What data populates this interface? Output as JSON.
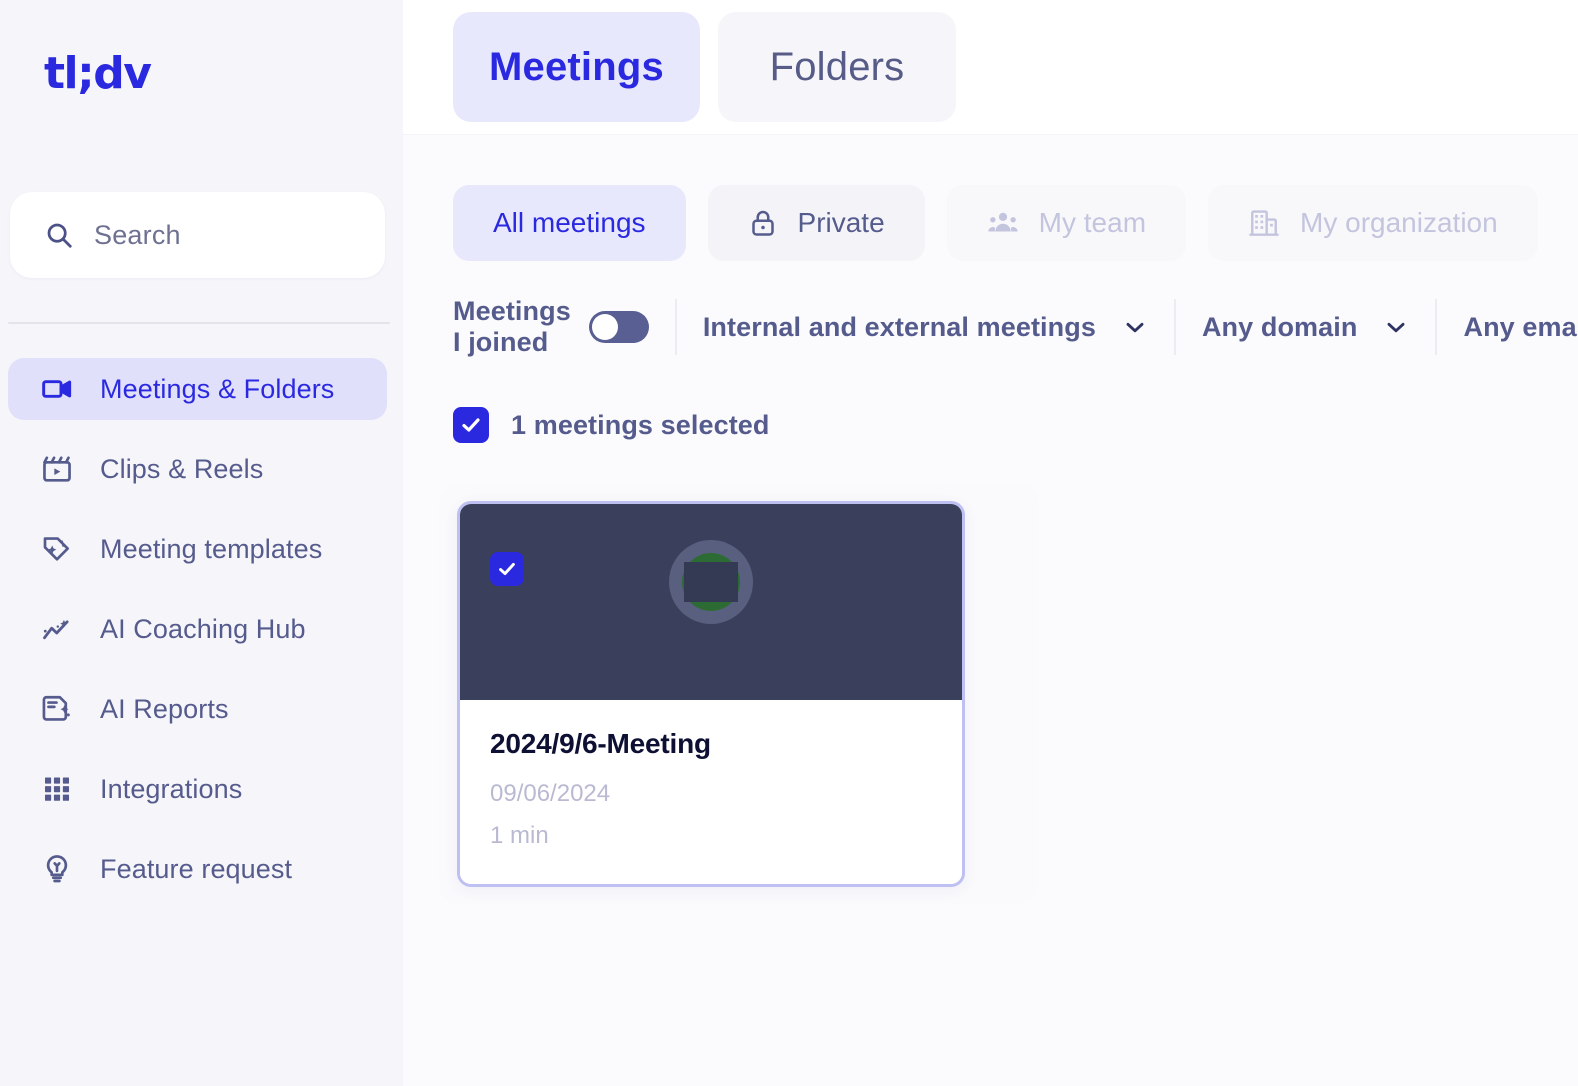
{
  "brand": {
    "logo_text": "tl;dv",
    "accent": "#2b29e0",
    "accent_soft": "#e8e8fd",
    "sidebar_bg": "#f5f5fa",
    "muted_text": "#555b8c",
    "disabled_text": "#c3c4de"
  },
  "sidebar": {
    "search": {
      "placeholder": "Search",
      "value": "",
      "icon": "search-icon"
    },
    "items": [
      {
        "label": "Meetings & Folders",
        "icon": "video-camera-icon",
        "active": true
      },
      {
        "label": "Clips & Reels",
        "icon": "clapperboard-icon",
        "active": false
      },
      {
        "label": "Meeting templates",
        "icon": "tag-sparkle-icon",
        "active": false
      },
      {
        "label": "AI Coaching Hub",
        "icon": "trend-sparkle-icon",
        "active": false
      },
      {
        "label": "AI Reports",
        "icon": "document-sparkle-icon",
        "active": false
      },
      {
        "label": "Integrations",
        "icon": "grid-dots-icon",
        "active": false
      },
      {
        "label": "Feature request",
        "icon": "lightbulb-icon",
        "active": false
      }
    ]
  },
  "topbar": {
    "tabs": [
      {
        "label": "Meetings",
        "active": true
      },
      {
        "label": "Folders",
        "active": false
      }
    ]
  },
  "filters": {
    "pills": [
      {
        "label": "All meetings",
        "icon": null,
        "state": "active"
      },
      {
        "label": "Private",
        "icon": "lock-icon",
        "state": "normal"
      },
      {
        "label": "My team",
        "icon": "people-group-icon",
        "state": "disabled"
      },
      {
        "label": "My organization",
        "icon": "building-icon",
        "state": "disabled"
      }
    ],
    "joined_toggle": {
      "label": "Meetings I joined",
      "on": false
    },
    "scope_select": {
      "value": "Internal and external meetings",
      "icon": "chevron-down-icon"
    },
    "domain_select": {
      "value": "Any domain",
      "icon": "chevron-down-icon"
    },
    "email_select": {
      "value": "Any email"
    }
  },
  "selection": {
    "checked": true,
    "label": "1 meetings selected"
  },
  "meetings": [
    {
      "title": "2024/9/6-Meeting",
      "date": "09/06/2024",
      "duration": "1 min",
      "selected": true,
      "thumbnail": {
        "background": "#3a3f5c",
        "avatar_color": "#595f7e",
        "accent_color": "#2d6b34"
      }
    }
  ]
}
